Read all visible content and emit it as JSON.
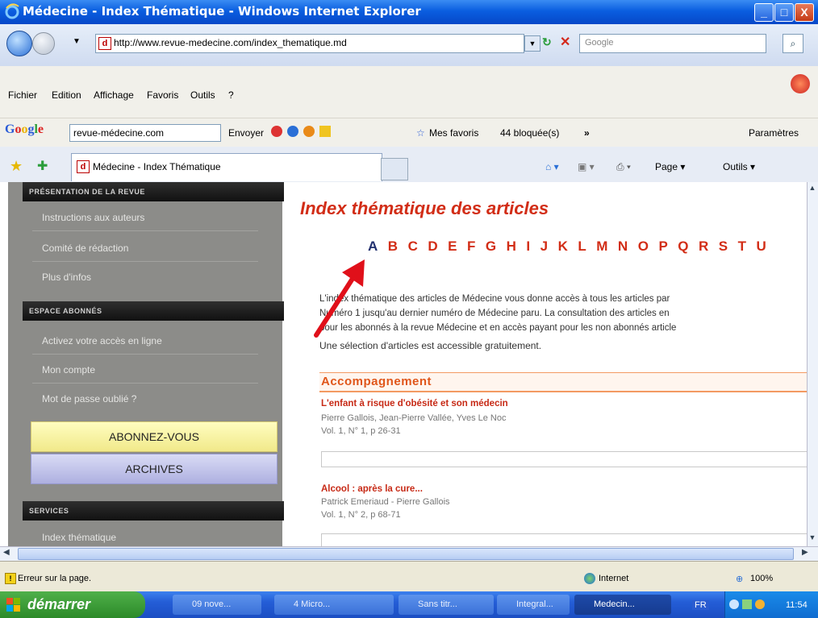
{
  "window": {
    "title": "Médecine - Index Thématique - Windows Internet Explorer",
    "minimize": "_",
    "maximize": "□",
    "close": "X"
  },
  "address": {
    "url": "http://www.revue-medecine.com/index_thematique.md",
    "search_placeholder": "Google"
  },
  "menu": [
    "Fichier",
    "Edition",
    "Affichage",
    "Favoris",
    "Outils",
    "?"
  ],
  "google_toolbar": {
    "logo": "Google",
    "input": "revue-médecine.com",
    "envoyer": "Envoyer",
    "favoris": "Mes favoris",
    "bloquees": "44 bloquée(s)",
    "more": "»",
    "parametres": "Paramètres"
  },
  "tab": {
    "favicon": "d",
    "title": "Médecine - Index Thématique"
  },
  "command_bar": {
    "page": "Page",
    "outils": "Outils"
  },
  "sidebar": {
    "section_presentation": "PRÉSENTATION DE LA REVUE",
    "items_presentation": [
      "Instructions aux auteurs",
      "Comité de rédaction",
      "Plus d'infos"
    ],
    "section_abonnes": "ESPACE ABONNÉS",
    "items_abonnes": [
      "Activez votre accès en ligne",
      "Mon compte",
      "Mot de passe oublié ?"
    ],
    "btn_abonnez": "ABONNEZ-VOUS",
    "btn_archives": "ARCHIVES",
    "section_services": "SERVICES",
    "items_services": [
      "Index thématique"
    ]
  },
  "main": {
    "title": "Index thématique des articles",
    "alphabet": [
      "A",
      "B",
      "C",
      "D",
      "E",
      "F",
      "G",
      "H",
      "I",
      "J",
      "K",
      "L",
      "M",
      "N",
      "O",
      "P",
      "Q",
      "R",
      "S",
      "T",
      "U"
    ],
    "intro_lines": [
      "L'index thématique des articles de Médecine vous donne accès à tous les articles par",
      "Numéro 1 jusqu'au dernier numéro de Médecine paru. La consultation des articles en",
      "pour les abonnés à la revue Médecine et en accès payant pour les non abonnés article"
    ],
    "free_line": "Une sélection d'articles est accessible gratuitement.",
    "section": "Accompagnement",
    "articles": [
      {
        "title": "L'enfant à risque d'obésité et son médecin",
        "authors": "Pierre Gallois, Jean-Pierre Vallée, Yves Le Noc",
        "ref": "Vol. 1, N° 1, p 26-31"
      },
      {
        "title": "Alcool : après la cure...",
        "authors": "Patrick Emeriaud - Pierre Gallois",
        "ref": "Vol. 1, N° 2, p 68-71"
      }
    ]
  },
  "status": {
    "error": "Erreur sur la page.",
    "zone": "Internet",
    "zoom": "100%"
  },
  "taskbar": {
    "start": "démarrer",
    "tasks": [
      "09 nove...",
      "4 Micro...",
      "Sans titr...",
      "Integral...",
      "Medecin..."
    ],
    "lang": "FR",
    "clock": "11:54"
  },
  "colors": {
    "accent_red": "#d22d16",
    "sidebar_gray": "#8c8c89",
    "section_orange": "#e0561a",
    "arrow_red": "#e0101a"
  }
}
